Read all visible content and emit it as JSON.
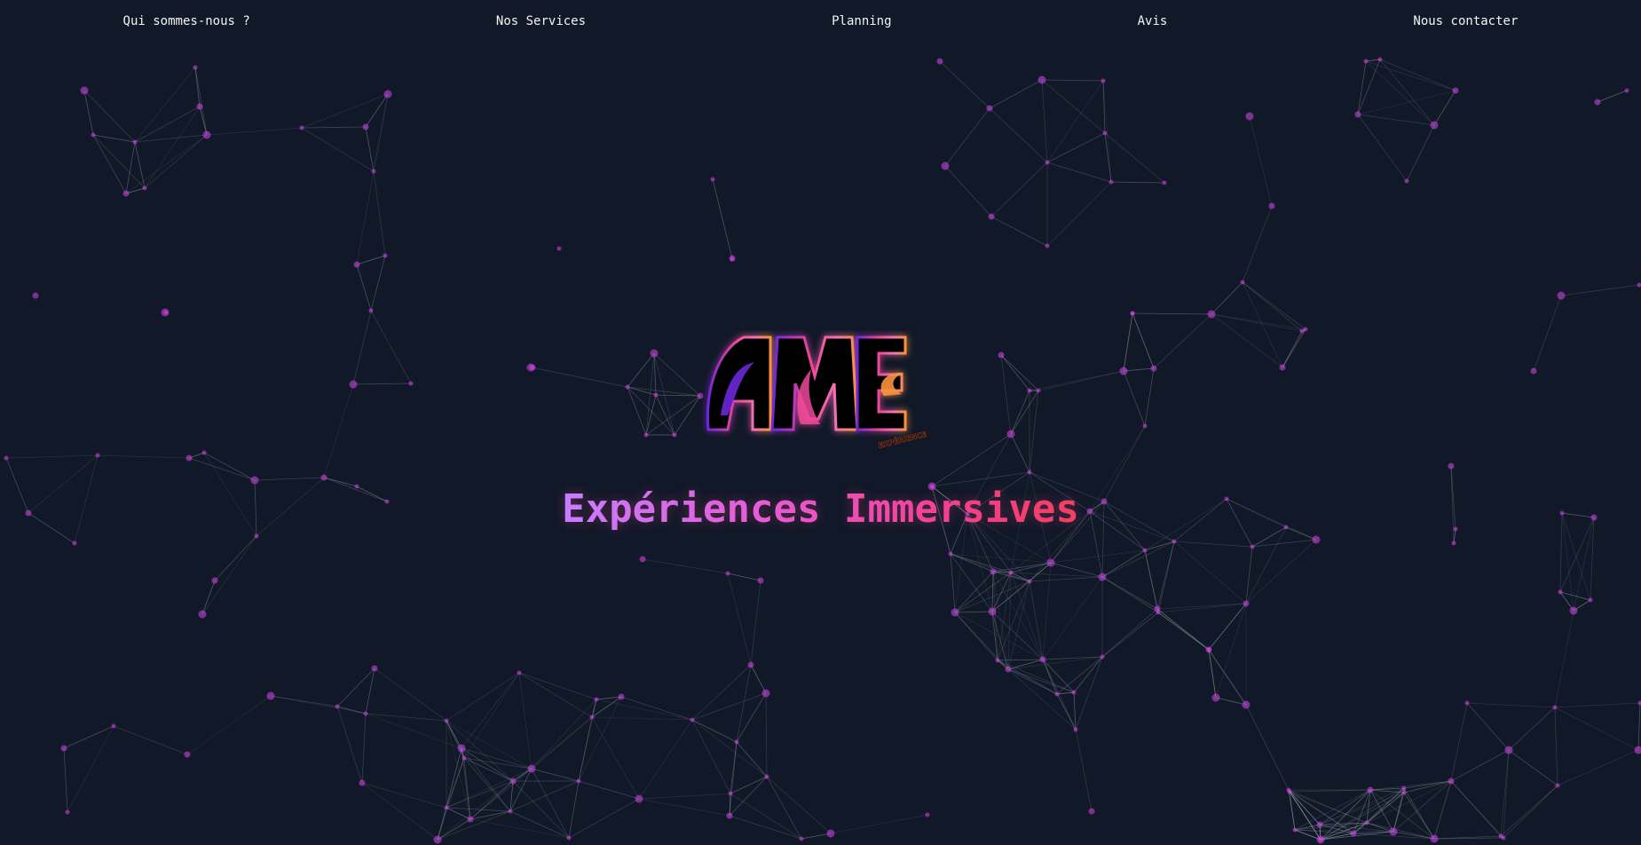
{
  "nav": {
    "items": [
      {
        "label": "Qui sommes-nous ?"
      },
      {
        "label": "Nos Services"
      },
      {
        "label": "Planning"
      },
      {
        "label": "Avis"
      },
      {
        "label": "Nous contacter"
      }
    ]
  },
  "logo": {
    "brand": "AME",
    "sub": "EXPÉRIENCE"
  },
  "hero": {
    "tagline": "Expériences Immersives"
  },
  "colors": {
    "background": "#111827",
    "node": "#d946ef",
    "line": "#9ca3af",
    "gradient": [
      "#7c3aed",
      "#ec4899",
      "#fb923c"
    ]
  }
}
